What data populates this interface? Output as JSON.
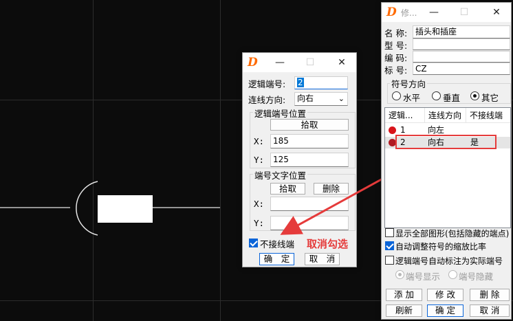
{
  "colors": {
    "accent_red": "#e53b3b",
    "brand_orange": "#ff6a00",
    "check_blue": "#0a64d8"
  },
  "pin_dialog": {
    "title": "",
    "titlebar": {
      "minimize": "—",
      "maximize": "☐",
      "close": "✕"
    },
    "pin_number_label": "逻辑端号:",
    "pin_number_value": "2",
    "direction_label": "连线方向:",
    "direction_value": "向右",
    "pin_pos_group": "逻辑端号位置",
    "pick_button": "拾取",
    "x_label": "X:",
    "x_value": "185",
    "y_label": "Y:",
    "y_value": "125",
    "text_pos_group": "端号文字位置",
    "pick2_button": "拾取",
    "delete_button": "删除",
    "x2_label": "X:",
    "x2_value": "",
    "y2_label": "Y:",
    "y2_value": "",
    "no_connect_label": "不接线端",
    "no_connect_checked": true,
    "ok_button": "确　定",
    "cancel_button": "取　消"
  },
  "annotation": {
    "text": "取消勾选"
  },
  "symbol_dialog": {
    "title": "修...",
    "titlebar": {
      "minimize": "—",
      "maximize": "☐",
      "close": "✕"
    },
    "name_label": "名 称:",
    "name_value": "插头和插座",
    "model_label": "型 号:",
    "model_value": "",
    "code_label": "编 码:",
    "code_value": "",
    "tag_label": "标 号:",
    "tag_value": "CZ",
    "direction_group": "符号方向",
    "radio_horizontal": "水平",
    "radio_vertical": "垂直",
    "radio_other": "其它",
    "radio_selected": "其它",
    "table": {
      "headers": [
        "逻辑...",
        "连线方向",
        "不接线端"
      ],
      "rows": [
        {
          "num": "1",
          "dir": "向左",
          "nc": ""
        },
        {
          "num": "2",
          "dir": "向右",
          "nc": "是"
        }
      ]
    },
    "opt_show_all": "显示全部图形(包括隐藏的端点)",
    "opt_show_all_checked": false,
    "opt_auto_scale": "自动调整符号的缩放比率",
    "opt_auto_scale_checked": true,
    "opt_auto_label": "逻辑端号自动标注为实际端号",
    "opt_auto_label_checked": false,
    "radio_pin_show": "端号显示",
    "radio_pin_hide": "端号隐藏",
    "btn_add": "添 加",
    "btn_modify": "修 改",
    "btn_delete": "删 除",
    "btn_refresh": "刷新",
    "btn_ok": "确 定",
    "btn_cancel": "取 消"
  }
}
